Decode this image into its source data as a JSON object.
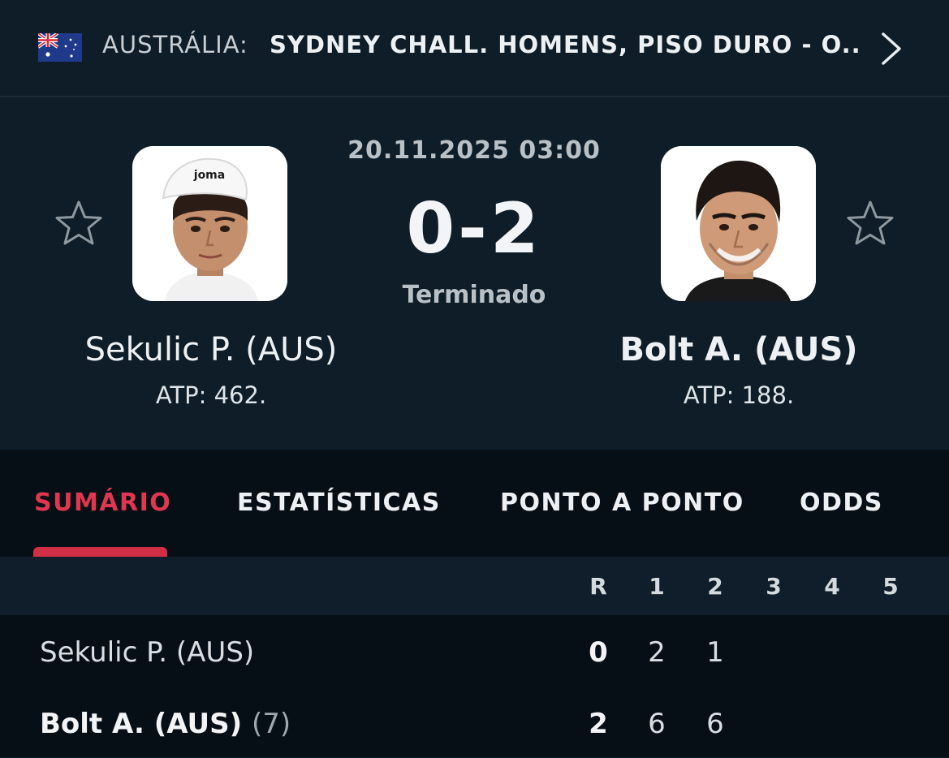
{
  "header": {
    "country": "AUSTRÁLIA:",
    "tournament": "SYDNEY CHALL. HOMENS, PISO DURO - O...",
    "flag_icon": "australia-flag-icon",
    "next_icon": "chevron-right-icon"
  },
  "match": {
    "date": "20.11.2025 03:00",
    "score": "0-2",
    "status": "Terminado",
    "home": {
      "name": "Sekulic P. (AUS)",
      "rank": "ATP: 462."
    },
    "away": {
      "name": "Bolt A. (AUS)",
      "rank": "ATP: 188."
    }
  },
  "tabs": [
    {
      "label": "SUMÁRIO",
      "active": true
    },
    {
      "label": "ESTATÍSTICAS",
      "active": false
    },
    {
      "label": "PONTO A PONTO",
      "active": false
    },
    {
      "label": "ODDS",
      "active": false
    }
  ],
  "scoreboard": {
    "columns": [
      "R",
      "1",
      "2",
      "3",
      "4",
      "5"
    ],
    "rows": [
      {
        "name": "Sekulic P. (AUS)",
        "seed": "",
        "total": "0",
        "sets": [
          "2",
          "1",
          "",
          "",
          ""
        ]
      },
      {
        "name": "Bolt A. (AUS)",
        "seed": "(7)",
        "total": "2",
        "sets": [
          "6",
          "6",
          "",
          "",
          ""
        ]
      }
    ]
  },
  "colors": {
    "background": "#0d1a24",
    "tab_bar": "#070f16",
    "accent": "#e0364f"
  }
}
